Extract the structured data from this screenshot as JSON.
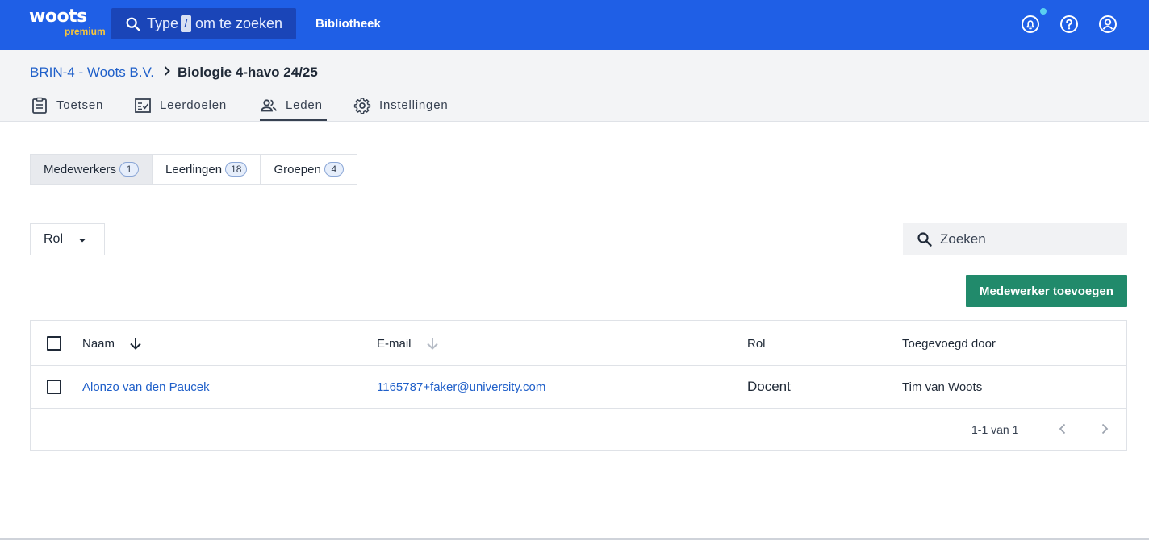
{
  "topbar": {
    "logo_text": "woots",
    "logo_sub": "premium",
    "search_prefix": "Type",
    "search_key": "/",
    "search_suffix": "om te zoeken",
    "library_label": "Bibliotheek",
    "icons": [
      "notifications-icon",
      "help-icon",
      "account-icon"
    ],
    "colors": {
      "bar": "#1f5fe6",
      "search": "#1a45b8",
      "logo_sub": "#f8c63b"
    }
  },
  "breadcrumb": {
    "root": "BRIN-4 - Woots B.V.",
    "current": "Biologie 4-havo 24/25"
  },
  "tabs": [
    {
      "label": "Toetsen",
      "icon": "clipboard-icon"
    },
    {
      "label": "Leerdoelen",
      "icon": "checklist-icon"
    },
    {
      "label": "Leden",
      "icon": "people-icon",
      "active": true
    },
    {
      "label": "Instellingen",
      "icon": "gear-icon"
    }
  ],
  "segments": [
    {
      "label": "Medewerkers",
      "count": "1",
      "active": true
    },
    {
      "label": "Leerlingen",
      "count": "18"
    },
    {
      "label": "Groepen",
      "count": "4"
    }
  ],
  "filter": {
    "rol_label": "Rol"
  },
  "search": {
    "placeholder": "Zoeken"
  },
  "add_button": "Medewerker toevoegen",
  "table": {
    "columns": [
      "Naam",
      "E-mail",
      "Rol",
      "Toegevoegd door"
    ],
    "rows": [
      {
        "naam": "Alonzo van den Paucek",
        "email": "1165787+faker@university.com",
        "rol": "Docent",
        "toegevoegd_door": "Tim van Woots"
      }
    ],
    "pagination": "1-1 van 1"
  },
  "accent_colors": {
    "primary_button": "#218a6b",
    "link": "#1f5fc9"
  }
}
